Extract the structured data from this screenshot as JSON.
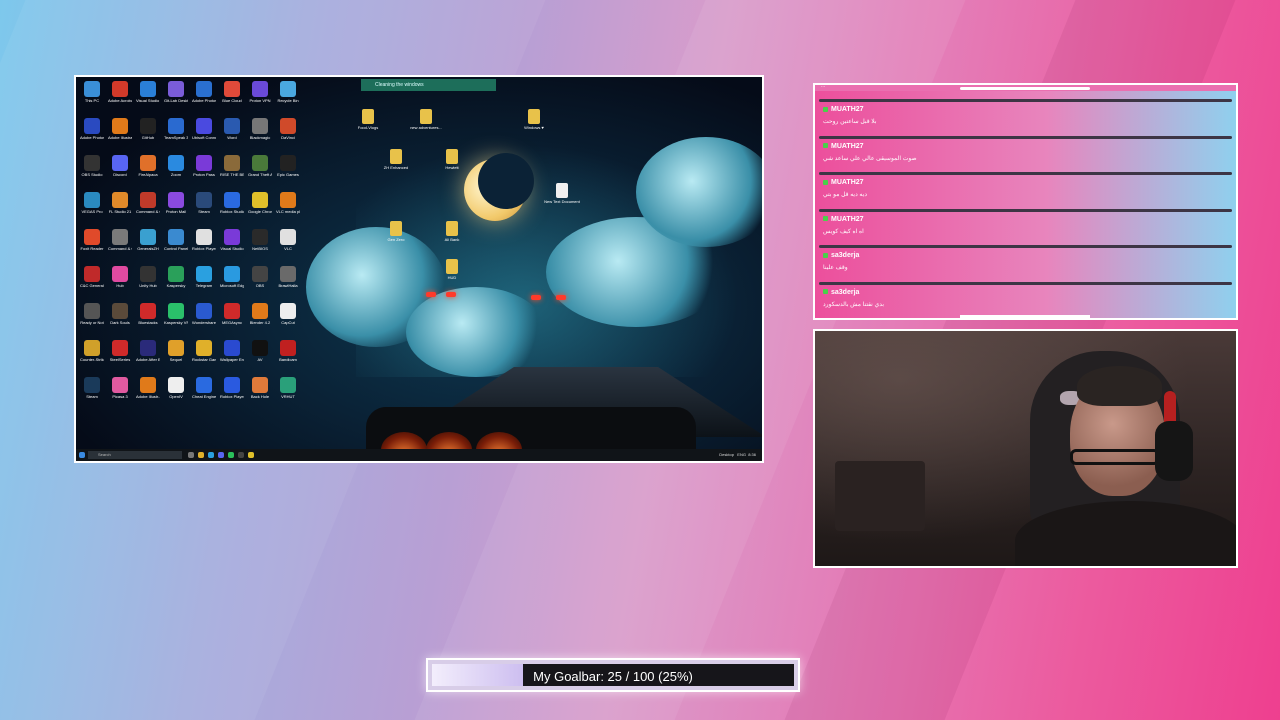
{
  "screen": {
    "notification": "Cleaning the windows",
    "taskbar": {
      "search_placeholder": "Search",
      "desktop_label": "Desktop",
      "lang": "ENG",
      "time": "8:36"
    },
    "desktop_icons": [
      {
        "label": "This PC",
        "color": "#3a8fd8"
      },
      {
        "label": "Adobe Acrobat",
        "color": "#d23a2a"
      },
      {
        "label": "Visual Studio Code",
        "color": "#2a7fd8"
      },
      {
        "label": "Git-Lab Desktop",
        "color": "#7a5cd8"
      },
      {
        "label": "Adobe Photoshop",
        "color": "#2a6fd0"
      },
      {
        "label": "Blue Cloud",
        "color": "#e04a3a"
      },
      {
        "label": "Proton VPN",
        "color": "#6a4ad8"
      },
      {
        "label": "Recycle Bin",
        "color": "#4aa8e0"
      },
      {
        "label": "Adobe Photosh...",
        "color": "#2a4ac0"
      },
      {
        "label": "Adobe Illustrator",
        "color": "#e07a1a"
      },
      {
        "label": "GitHub",
        "color": "#222"
      },
      {
        "label": "TeamSpeak 3 Client",
        "color": "#2a6ad0"
      },
      {
        "label": "Ubisoft Connect",
        "color": "#4a4ae0"
      },
      {
        "label": "Word",
        "color": "#2a5ab0"
      },
      {
        "label": "Blackmagic",
        "color": "#777"
      },
      {
        "label": "DaVinci",
        "color": "#d04a2a"
      },
      {
        "label": "OBS Studio",
        "color": "#333"
      },
      {
        "label": "Discord",
        "color": "#5865f2"
      },
      {
        "label": "FireAlpaca",
        "color": "#e0702a"
      },
      {
        "label": "Zoom",
        "color": "#2a8ae0"
      },
      {
        "label": "Proton Pass",
        "color": "#7a3ad8"
      },
      {
        "label": "RISE THE BEAST",
        "color": "#8a6a3a"
      },
      {
        "label": "Grand Theft Auto",
        "color": "#4a7a3a"
      },
      {
        "label": "Epic Games",
        "color": "#222"
      },
      {
        "label": "VEGAS Pro",
        "color": "#2a8ac0"
      },
      {
        "label": "FL Studio 21",
        "color": "#e08a2a"
      },
      {
        "label": "Command & Conquer",
        "color": "#c03a2a"
      },
      {
        "label": "Proton Mail",
        "color": "#8a4ae0"
      },
      {
        "label": "Steam",
        "color": "#2a4a7a"
      },
      {
        "label": "Roblox Studio",
        "color": "#2a6ae0"
      },
      {
        "label": "Google Chrome",
        "color": "#e0c02a"
      },
      {
        "label": "VLC media player",
        "color": "#e07a1a"
      },
      {
        "label": "Foxit Reader",
        "color": "#e04a2a"
      },
      {
        "label": "Command & Conquer",
        "color": "#7a7a7a"
      },
      {
        "label": "GeneralsZH",
        "color": "#3aa0d0"
      },
      {
        "label": "Control Panel",
        "color": "#3a8ad0"
      },
      {
        "label": "Roblox Player",
        "color": "#e0e0e0"
      },
      {
        "label": "Visual Studio",
        "color": "#7a3ad8"
      },
      {
        "label": "NetBIOS",
        "color": "#2a2a2a"
      },
      {
        "label": "VLC",
        "color": "#e0e0e0"
      },
      {
        "label": "C&C Generals",
        "color": "#c02a2a"
      },
      {
        "label": "Hub",
        "color": "#e04aa0"
      },
      {
        "label": "Unity Hub",
        "color": "#333"
      },
      {
        "label": "Kaspersky",
        "color": "#2aa05a"
      },
      {
        "label": "Telegram",
        "color": "#2aa0e0"
      },
      {
        "label": "Microsoft Edge",
        "color": "#2a9ae0"
      },
      {
        "label": "OBS",
        "color": "#444"
      },
      {
        "label": "BrawlHalla",
        "color": "#6a6a6a"
      },
      {
        "label": "Ready or Not",
        "color": "#555"
      },
      {
        "label": "Dark Souls",
        "color": "#5a4a3a"
      },
      {
        "label": "Bluestacks",
        "color": "#d02a2a"
      },
      {
        "label": "Kaspersky VPN",
        "color": "#2ac06a"
      },
      {
        "label": "Wondershare",
        "color": "#2a5ad0"
      },
      {
        "label": "MEGAsync",
        "color": "#d02a2a"
      },
      {
        "label": "Blender 4.2",
        "color": "#e07a1a"
      },
      {
        "label": "CapCut",
        "color": "#eee"
      },
      {
        "label": "Counter-Strike Global Offe...",
        "color": "#d0a02a"
      },
      {
        "label": "SteelSeries",
        "color": "#d02a2a"
      },
      {
        "label": "Adobe After Effects 2022",
        "color": "#2a2a7a"
      },
      {
        "label": "Sequel",
        "color": "#e0a02a"
      },
      {
        "label": "Rockstar Games",
        "color": "#e0b02a"
      },
      {
        "label": "Wallpaper Engine",
        "color": "#2a4ad0"
      },
      {
        "label": "AV",
        "color": "#111"
      },
      {
        "label": "Bandicam",
        "color": "#c02020"
      },
      {
        "label": "Steam",
        "color": "#1a3a5a"
      },
      {
        "label": "Picasa 3",
        "color": "#e05aa0"
      },
      {
        "label": "Adobe Illustr...",
        "color": "#e07a1a"
      },
      {
        "label": "OpenIV",
        "color": "#eee"
      },
      {
        "label": "Cheat Engine",
        "color": "#2a6ae0"
      },
      {
        "label": "Roblox Player",
        "color": "#2a5ae0"
      },
      {
        "label": "Back Hole",
        "color": "#e07a3a"
      },
      {
        "label": "VRHUT",
        "color": "#2aa07a"
      }
    ],
    "desktop_files": [
      {
        "label": "Food-Vlogs"
      },
      {
        "label": "new adventures..."
      },
      {
        "label": "Windows ♥"
      },
      {
        "label": "ZH Enhanced"
      },
      {
        "label": "Hewlett"
      },
      {
        "label": "New Text Document"
      },
      {
        "label": "Gen Zero"
      },
      {
        "label": "Ali Bank"
      },
      {
        "label": "HUD"
      }
    ]
  },
  "chat": {
    "header_text": "...",
    "messages": [
      {
        "user": "MUATH27",
        "text": "بلا قبل ساعتين روحت"
      },
      {
        "user": "MUATH27",
        "text": "صوت الموسيقى عالي علي ساعد شي"
      },
      {
        "user": "MUATH27",
        "text": "ديه ديه قل مو بتي"
      },
      {
        "user": "MUATH27",
        "text": "اه اه كيف كويس"
      },
      {
        "user": "sa3derja",
        "text": "وقف علينا"
      },
      {
        "user": "sa3derja",
        "text": "بدي نقتنا مش بالدسكورد"
      }
    ]
  },
  "goal": {
    "label": "My Goalbar:  25 / 100 (25%)",
    "current": 25,
    "target": 100,
    "fraction": 0.25
  }
}
